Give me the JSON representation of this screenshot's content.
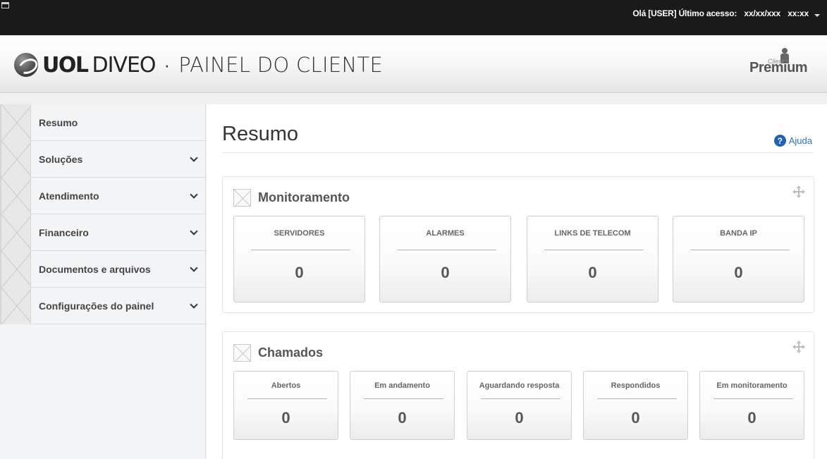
{
  "topbar": {
    "greeting": "Olá [USER]",
    "last_access_label": "Último acesso:",
    "last_access_date": "xx/xx/xxx",
    "last_access_time": "xx:xx"
  },
  "header": {
    "logo_uol": "UOL",
    "logo_diveo": "DIVEO",
    "logo_separator": "·",
    "logo_title": "PAINEL DO CLIENTE",
    "premium_small": "Cliente",
    "premium_word": "Premium"
  },
  "sidebar": {
    "items": [
      {
        "label": "Resumo",
        "has_chevron": false
      },
      {
        "label": "Soluções",
        "has_chevron": true
      },
      {
        "label": "Atendimento",
        "has_chevron": true
      },
      {
        "label": "Financeiro",
        "has_chevron": true
      },
      {
        "label": "Documentos e arquivos",
        "has_chevron": true
      },
      {
        "label": "Configurações do painel",
        "has_chevron": true
      }
    ]
  },
  "main": {
    "title": "Resumo",
    "help_icon": "?",
    "help_label": "Ajuda",
    "monitoring": {
      "title": "Monitoramento",
      "cards": [
        {
          "label": "SERVIDORES",
          "value": "0"
        },
        {
          "label": "ALARMES",
          "value": "0"
        },
        {
          "label": "LINKS DE TELECOM",
          "value": "0"
        },
        {
          "label": "BANDA IP",
          "value": "0"
        }
      ]
    },
    "tickets": {
      "title": "Chamados",
      "cards": [
        {
          "label": "Abertos",
          "value": "0"
        },
        {
          "label": "Em andamento",
          "value": "0"
        },
        {
          "label": "Aguardando resposta",
          "value": "0"
        },
        {
          "label": "Respondidos",
          "value": "0"
        },
        {
          "label": "Em monitoramento",
          "value": "0"
        }
      ]
    }
  },
  "colors": {
    "topbar": "#1a1a1a",
    "accent_link": "#2a6fb7",
    "help_icon_bg": "#1e63b6"
  },
  "icons": {
    "menu_placeholder": "broken-image-icon",
    "panel_placeholder": "broken-image-icon",
    "move": "move-arrows-icon",
    "help": "question-circle-icon",
    "dropdown": "caret-down-icon",
    "chevron": "chevron-down-icon"
  }
}
